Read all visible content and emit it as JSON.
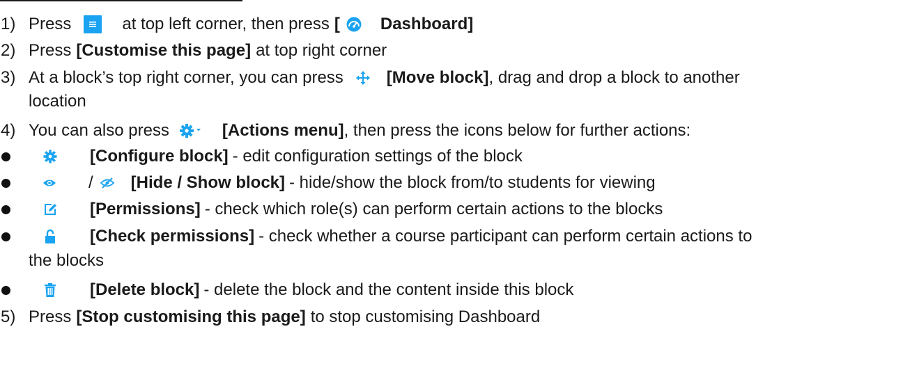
{
  "steps": [
    {
      "num": "1)",
      "pre": "Press",
      "mid": "at top left corner, then press",
      "bracket_open": "[",
      "label": "Dashboard]"
    },
    {
      "num": "2)",
      "pre": "Press",
      "label": "[Customise this page]",
      "post": "at top right corner"
    },
    {
      "num": "3)",
      "pre": "At a block’s top right corner, you can press",
      "label": "[Move block]",
      "post": ", drag and drop a block to another",
      "cont": "location"
    },
    {
      "num": "4)",
      "pre": "You can also press",
      "label": "[Actions menu]",
      "post": ", then press the icons below for further actions:"
    },
    {
      "num": "5)",
      "pre": "Press",
      "label": "[Stop customising this page]",
      "post": "to stop customising Dashboard"
    }
  ],
  "bullets": [
    {
      "icon": "gear-icon",
      "label": "[Configure block]",
      "text": "- edit configuration settings of the block"
    },
    {
      "icon": "eye-icon",
      "separator": "/",
      "label": "[Hide / Show block]",
      "text": "- hide/show the block from/to students for viewing"
    },
    {
      "icon": "edit-icon",
      "label": "[Permissions]",
      "text": "- check which role(s) can perform certain actions to the blocks"
    },
    {
      "icon": "unlock-icon",
      "label": "[Check permissions]",
      "text": "- check whether a course participant can perform certain actions to",
      "cont": "the blocks"
    },
    {
      "icon": "trash-icon",
      "label": "[Delete block]",
      "text": "- delete the block and the content inside this block"
    }
  ],
  "colors": {
    "icon_blue": "#1aa3f0",
    "text": "#1a1a1a"
  }
}
